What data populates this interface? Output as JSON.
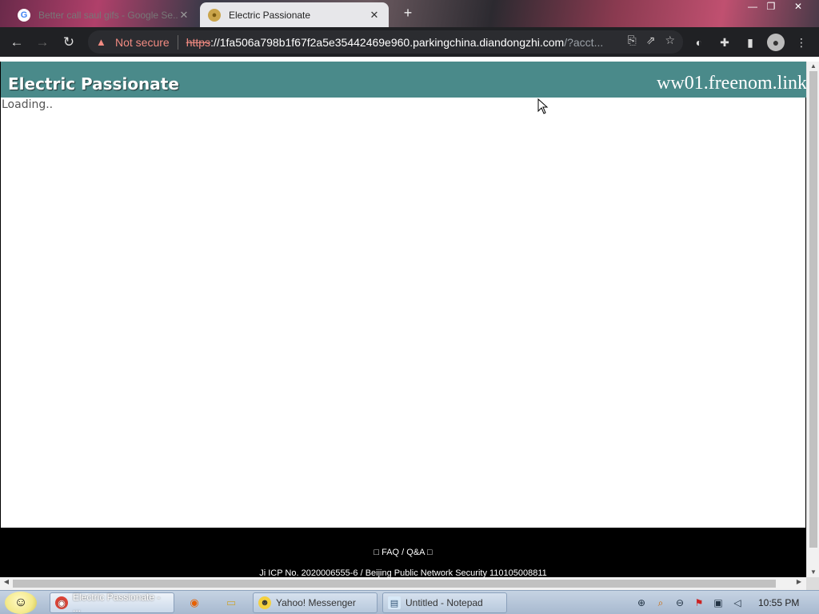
{
  "browser": {
    "tabs": [
      {
        "title": "Better call saul gifs - Google Se...",
        "active": false,
        "icon": "google-icon"
      },
      {
        "title": "Electric Passionate",
        "active": true,
        "icon": "site-favicon"
      }
    ],
    "new_tab_symbol": "+",
    "security_label": "Not secure",
    "url_scheme": "https",
    "url_rest_host": "://1fa506a798b1f67f2a5e35442469e960.parkingchina.diandongzhi.com",
    "url_path": "/?acct..."
  },
  "page": {
    "site_title": "Electric Passionate",
    "domain": "ww01.freenom.link",
    "loading_text": "Loading..",
    "footer_faq": "□ FAQ / Q&A □",
    "footer_icp": "Ji ICP No. 2020006555-6 / Beijing Public Network Security 110105008811"
  },
  "colors": {
    "banner": "#4a8a8a",
    "insecure": "#f28b82",
    "toolbar": "#202124"
  },
  "taskbar": {
    "items": [
      {
        "label": "Electric Passionate - ...",
        "icon": "chrome-icon",
        "active": true
      },
      {
        "label": "Yahoo! Messenger",
        "icon": "yahoo-messenger-icon",
        "active": false
      },
      {
        "label": "Untitled - Notepad",
        "icon": "notepad-icon",
        "active": false
      }
    ],
    "clock": "10:55 PM"
  }
}
